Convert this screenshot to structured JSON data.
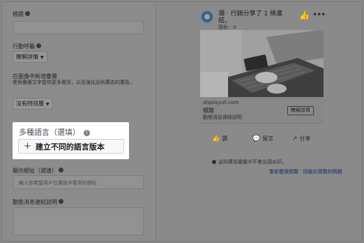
{
  "form": {
    "title_label": "標題",
    "cta_label": "行動呼籲",
    "cta_value": "瞭解詳情",
    "creative_label": "在圖像中新增疊層",
    "creative_help": "使用疊層文字提供更多資訊，以及強化這則廣告的廣告。",
    "creative_value": "沒有特效層",
    "multilang_title": "多種語言（選填）",
    "multilang_button": "建立不同的語言版本",
    "display_link_label": "顯示網址（選填）",
    "display_link_placeholder": "輸入你希望用戶在廣告中看到的網址",
    "news_feed_desc_label": "動態消息連結說明"
  },
  "preview": {
    "page_name": "潮 · 行銷分享了 1 條連結。",
    "sponsored": "贊助 · ⊘",
    "domain": "displayurl.com",
    "headline": "標題",
    "description": "動態消息連結說明",
    "learn_more": "瞭解詳情",
    "actions": [
      {
        "icon": "👍",
        "label": "讚"
      },
      {
        "icon": "💬",
        "label": "留言"
      },
      {
        "icon": "↗",
        "label": "分享"
      }
    ],
    "note": "這則廣告圖像中不會出現水印。",
    "links": "重新整理預覽 · 回報此預覽的問題"
  },
  "colors": {
    "overlay": "#888888",
    "highlight_bg": "#ffffff",
    "button_bg": "#f6f7f9",
    "link_color": "#16306a"
  }
}
